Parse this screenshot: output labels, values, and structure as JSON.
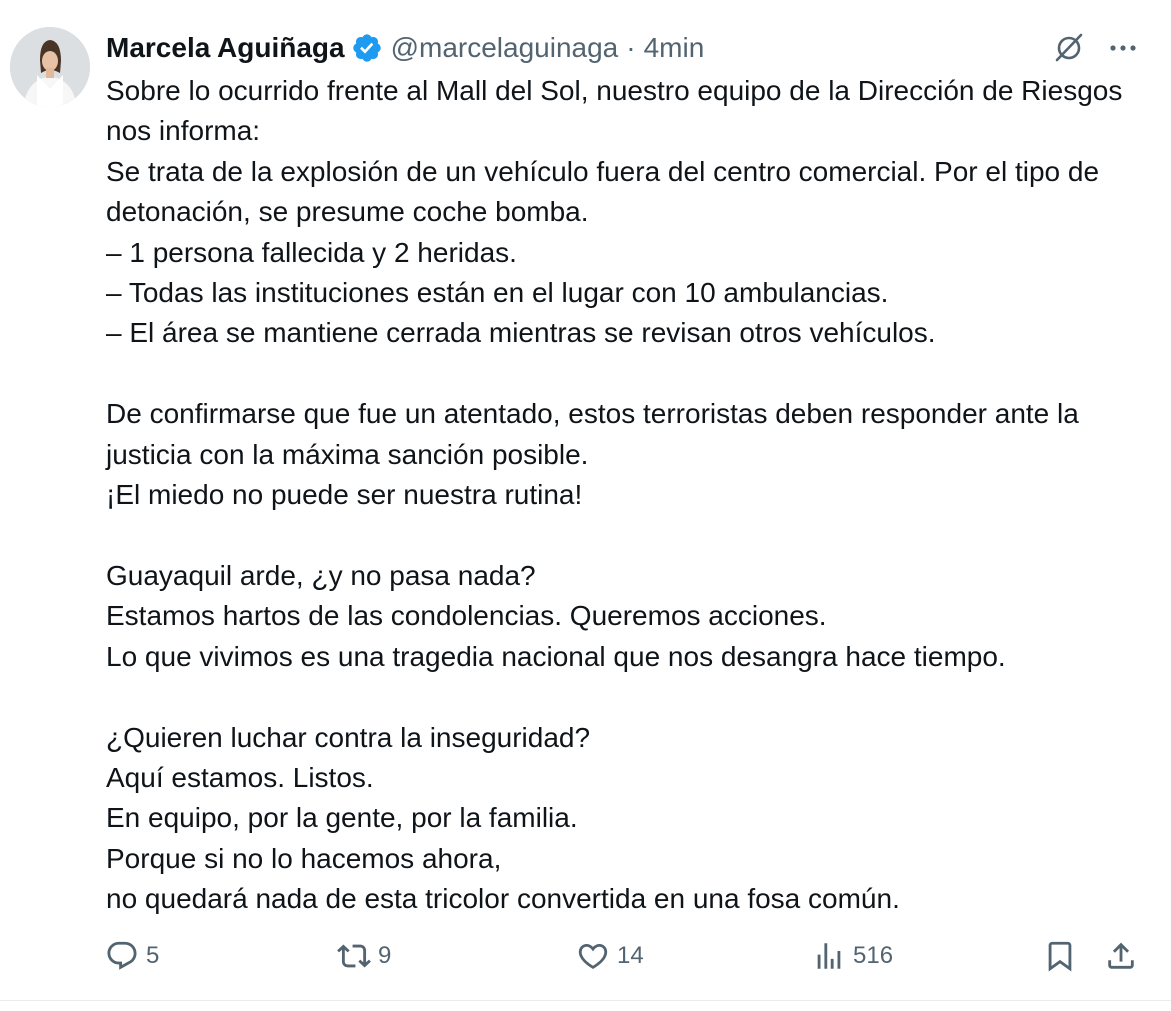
{
  "tweet": {
    "author": {
      "name": "Marcela Aguiñaga",
      "handle": "@marcelaguinaga",
      "separator": "·",
      "time": "4min",
      "verified": true
    },
    "text": "Sobre lo ocurrido frente al Mall del Sol, nuestro equipo de la Dirección de Riesgos nos informa:\nSe trata de la explosión de un vehículo fuera del centro comercial. Por el tipo de detonación, se presume coche bomba.\n– 1 persona fallecida y 2 heridas.\n– Todas las instituciones están en el lugar con 10 ambulancias.\n– El área se mantiene cerrada mientras se revisan otros vehículos.\n\nDe confirmarse que fue un atentado, estos terroristas deben responder ante la justicia con la máxima sanción posible.\n¡El miedo no puede ser nuestra rutina!\n\nGuayaquil arde, ¿y no pasa nada?\nEstamos hartos de las condolencias. Queremos acciones.\nLo que vivimos es una tragedia nacional que nos desangra hace tiempo.\n\n¿Quieren luchar contra la inseguridad?\nAquí estamos. Listos.\nEn equipo, por la gente, por la familia.\nPorque si no lo hacemos ahora,\nno quedará nada de esta tricolor convertida en una fosa común.",
    "stats": {
      "replies": "5",
      "reposts": "9",
      "likes": "14",
      "views": "516"
    }
  },
  "icons": {
    "verified": "verified-badge-icon",
    "grok": "grok-icon",
    "more": "more-icon",
    "reply": "reply-icon",
    "repost": "repost-icon",
    "like": "heart-icon",
    "views": "views-icon",
    "bookmark": "bookmark-icon",
    "share": "share-icon"
  },
  "colors": {
    "text": "#0f1419",
    "secondary": "#536471",
    "verified_blue": "#1d9bf0",
    "divider": "#e8ecef"
  }
}
